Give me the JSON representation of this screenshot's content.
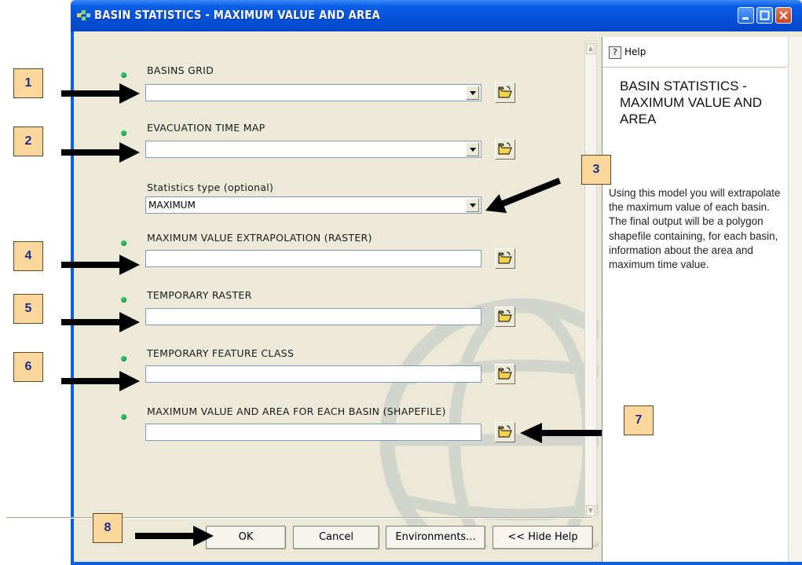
{
  "window": {
    "title": "BASIN STATISTICS - MAXIMUM VALUE AND AREA",
    "accent": "#0a5ee8"
  },
  "fields": [
    {
      "label": "BASINS GRID",
      "value": "",
      "required": true,
      "dropdown": true
    },
    {
      "label": "EVACUATION TIME MAP",
      "value": "",
      "required": true,
      "dropdown": true
    },
    {
      "label": "Statistics type (optional)",
      "value": "MAXIMUM",
      "required": false,
      "dropdown": true
    },
    {
      "label": "MAXIMUM VALUE EXTRAPOLATION (RASTER)",
      "value": "",
      "required": true,
      "dropdown": false
    },
    {
      "label": "TEMPORARY RASTER",
      "value": "",
      "required": true,
      "dropdown": false
    },
    {
      "label": "TEMPORARY FEATURE CLASS",
      "value": "",
      "required": true,
      "dropdown": false
    },
    {
      "label": "MAXIMUM VALUE AND AREA FOR EACH BASIN (SHAPEFILE)",
      "value": "",
      "required": true,
      "dropdown": false
    }
  ],
  "buttons": {
    "ok": "OK",
    "cancel": "Cancel",
    "environments": "Environments...",
    "hide_help": "<< Hide Help"
  },
  "help": {
    "tab_label": "Help",
    "title": "BASIN STATISTICS - MAXIMUM VALUE AND AREA",
    "body": "Using this model you will extrapolate the maximum value of each basin. The final output will be a polygon shapefile containing, for each basin, information about the area and maximum time value."
  },
  "callouts": [
    "1",
    "2",
    "3",
    "4",
    "5",
    "6",
    "7",
    "8"
  ],
  "colors": {
    "callout_fill": "#fbd79e",
    "callout_text": "#1c2e8a",
    "required_dot": "#22c55e"
  },
  "icons": [
    "app-icon",
    "minimize-icon",
    "maximize-icon",
    "close-icon",
    "folder-open-icon",
    "help-icon",
    "dropdown-arrow-icon",
    "arrow-icon"
  ]
}
